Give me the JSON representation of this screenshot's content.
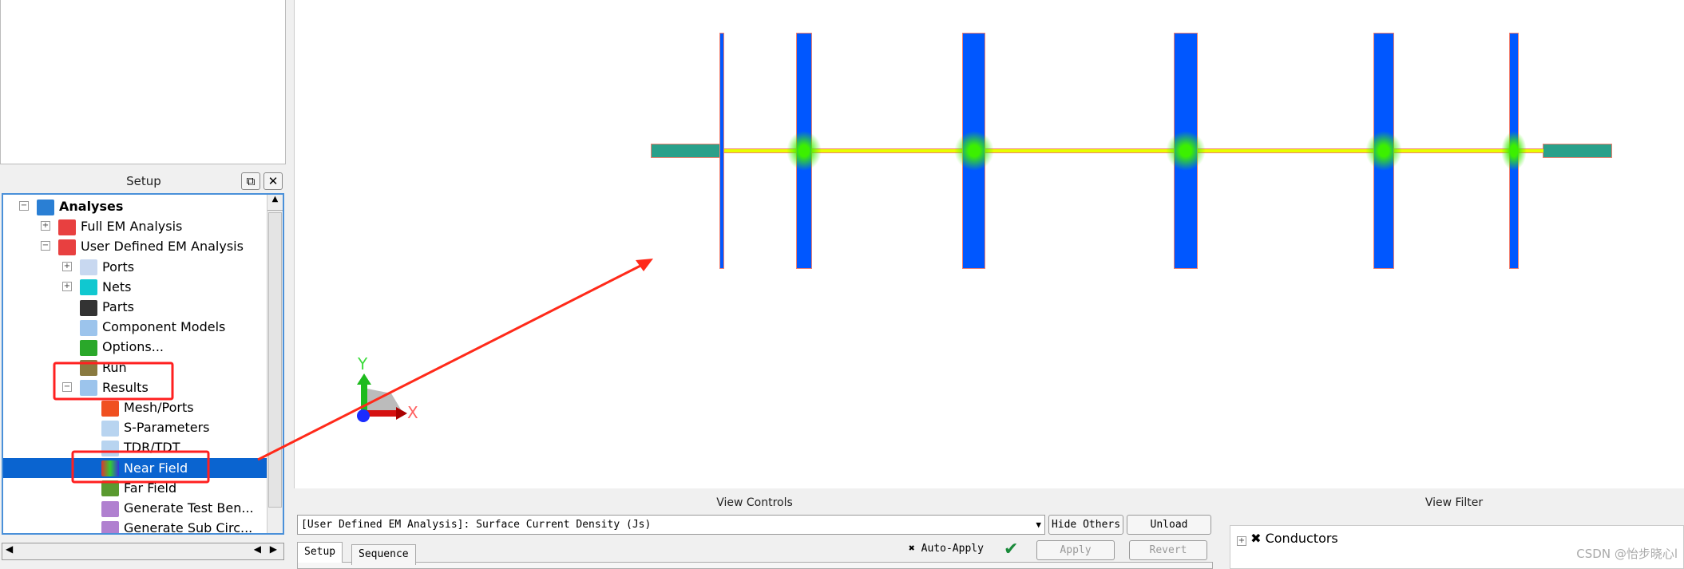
{
  "setup_panel": {
    "title": "Setup",
    "float_icon": "restore-icon",
    "close_icon": "close-icon",
    "tree": [
      {
        "label": "Analyses",
        "icon": "analyses-icon",
        "bold": true,
        "expand": "minus",
        "level": 0
      },
      {
        "label": "Full EM Analysis",
        "icon": "em-icon",
        "expand": "plus",
        "level": 1
      },
      {
        "label": "User Defined EM Analysis",
        "icon": "em-icon",
        "expand": "minus",
        "level": 1
      },
      {
        "label": "Ports",
        "icon": "ports-icon",
        "expand": "plus",
        "level": 2
      },
      {
        "label": "Nets",
        "icon": "nets-icon",
        "expand": "plus",
        "level": 2
      },
      {
        "label": "Parts",
        "icon": "parts-icon",
        "level": 2
      },
      {
        "label": "Component Models",
        "icon": "component-models-icon",
        "level": 2
      },
      {
        "label": "Options...",
        "icon": "wrench-icon",
        "level": 2
      },
      {
        "label": "Run",
        "icon": "run-gear-icon",
        "level": 2
      },
      {
        "label": "Results",
        "icon": "results-icon",
        "expand": "minus",
        "level": 2
      },
      {
        "label": "Mesh/Ports",
        "icon": "mesh-icon",
        "level": 3
      },
      {
        "label": "S-Parameters",
        "icon": "chart-icon",
        "level": 3
      },
      {
        "label": "TDR/TDT",
        "icon": "chart-icon",
        "level": 3
      },
      {
        "label": "Near Field",
        "icon": "near-field-icon",
        "level": 3,
        "selected": true
      },
      {
        "label": "Far Field",
        "icon": "far-field-icon",
        "level": 3
      },
      {
        "label": "Generate Test Ben...",
        "icon": "waveform-icon",
        "level": 3
      },
      {
        "label": "Generate Sub Circ...",
        "icon": "waveform-icon",
        "level": 3
      }
    ]
  },
  "viewport": {
    "axis": {
      "y": "Y",
      "x": "X"
    },
    "colors": {
      "stub": "#0057ff",
      "feed": "#2aa08a",
      "line": "#e8ff00",
      "annotation": "#ff2a1a"
    }
  },
  "view_controls": {
    "title": "View Controls",
    "combo_value": "[User Defined EM Analysis]: Surface Current Density (Js)",
    "hide_others": "Hide Others",
    "unload": "Unload",
    "tabs": [
      "Setup",
      "Sequence"
    ],
    "auto_apply": "Auto-Apply",
    "auto_apply_checked": true,
    "apply": "Apply",
    "revert": "Revert"
  },
  "view_filter": {
    "title": "View Filter",
    "items": [
      {
        "label": "Conductors",
        "checked": true
      }
    ]
  },
  "watermark": "CSDN @怡步晓心l"
}
